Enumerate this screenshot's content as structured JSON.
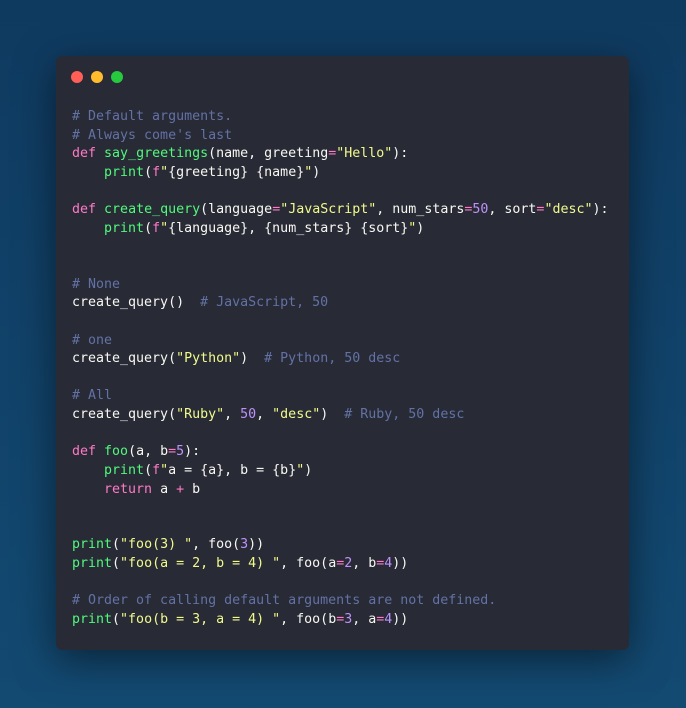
{
  "window": {
    "controls": [
      {
        "name": "close",
        "color": "#ff5f56"
      },
      {
        "name": "minimize",
        "color": "#ffbd2e"
      },
      {
        "name": "maximize",
        "color": "#27c93f"
      }
    ]
  },
  "theme": {
    "comment": "#6272a4",
    "keyword": "#ff79c6",
    "function": "#50fa7b",
    "string": "#f1fa8c",
    "number": "#bd93f9",
    "text": "#f8f8f2",
    "background": "#282a36"
  },
  "code": {
    "lines": [
      [
        [
          "c",
          "# Default arguments."
        ]
      ],
      [
        [
          "c",
          "# Always come's last"
        ]
      ],
      [
        [
          "k",
          "def"
        ],
        [
          "p",
          " "
        ],
        [
          "f",
          "say_greetings"
        ],
        [
          "p",
          "(name, greeting"
        ],
        [
          "o",
          "="
        ],
        [
          "s",
          "\"Hello\""
        ],
        [
          "p",
          "):"
        ]
      ],
      [
        [
          "p",
          "    "
        ],
        [
          "f",
          "print"
        ],
        [
          "p",
          "("
        ],
        [
          "k",
          "f"
        ],
        [
          "s",
          "\""
        ],
        [
          "p",
          "{greeting} {name}"
        ],
        [
          "s",
          "\""
        ],
        [
          "p",
          ")"
        ]
      ],
      [],
      [
        [
          "k",
          "def"
        ],
        [
          "p",
          " "
        ],
        [
          "f",
          "create_query"
        ],
        [
          "p",
          "(language"
        ],
        [
          "o",
          "="
        ],
        [
          "s",
          "\"JavaScript\""
        ],
        [
          "p",
          ", num_stars"
        ],
        [
          "o",
          "="
        ],
        [
          "n",
          "50"
        ],
        [
          "p",
          ", sort"
        ],
        [
          "o",
          "="
        ],
        [
          "s",
          "\"desc\""
        ],
        [
          "p",
          "):"
        ]
      ],
      [
        [
          "p",
          "    "
        ],
        [
          "f",
          "print"
        ],
        [
          "p",
          "("
        ],
        [
          "k",
          "f"
        ],
        [
          "s",
          "\""
        ],
        [
          "p",
          "{language}, {num_stars} {sort}"
        ],
        [
          "s",
          "\""
        ],
        [
          "p",
          ")"
        ]
      ],
      [],
      [],
      [
        [
          "c",
          "# None"
        ]
      ],
      [
        [
          "p",
          "create_query()  "
        ],
        [
          "c",
          "# JavaScript, 50"
        ]
      ],
      [],
      [
        [
          "c",
          "# one"
        ]
      ],
      [
        [
          "p",
          "create_query("
        ],
        [
          "s",
          "\"Python\""
        ],
        [
          "p",
          ")  "
        ],
        [
          "c",
          "# Python, 50 desc"
        ]
      ],
      [],
      [
        [
          "c",
          "# All"
        ]
      ],
      [
        [
          "p",
          "create_query("
        ],
        [
          "s",
          "\"Ruby\""
        ],
        [
          "p",
          ", "
        ],
        [
          "n",
          "50"
        ],
        [
          "p",
          ", "
        ],
        [
          "s",
          "\"desc\""
        ],
        [
          "p",
          ")  "
        ],
        [
          "c",
          "# Ruby, 50 desc"
        ]
      ],
      [],
      [
        [
          "k",
          "def"
        ],
        [
          "p",
          " "
        ],
        [
          "f",
          "foo"
        ],
        [
          "p",
          "(a, b"
        ],
        [
          "o",
          "="
        ],
        [
          "n",
          "5"
        ],
        [
          "p",
          "):"
        ]
      ],
      [
        [
          "p",
          "    "
        ],
        [
          "f",
          "print"
        ],
        [
          "p",
          "("
        ],
        [
          "k",
          "f"
        ],
        [
          "s",
          "\""
        ],
        [
          "p",
          "a = {a}, b = {b}"
        ],
        [
          "s",
          "\""
        ],
        [
          "p",
          ")"
        ]
      ],
      [
        [
          "p",
          "    "
        ],
        [
          "k",
          "return"
        ],
        [
          "p",
          " a "
        ],
        [
          "o",
          "+"
        ],
        [
          "p",
          " b"
        ]
      ],
      [],
      [],
      [
        [
          "f",
          "print"
        ],
        [
          "p",
          "("
        ],
        [
          "s",
          "\"foo(3) \""
        ],
        [
          "p",
          ", foo("
        ],
        [
          "n",
          "3"
        ],
        [
          "p",
          "))"
        ]
      ],
      [
        [
          "f",
          "print"
        ],
        [
          "p",
          "("
        ],
        [
          "s",
          "\"foo(a = 2, b = 4) \""
        ],
        [
          "p",
          ", foo(a"
        ],
        [
          "o",
          "="
        ],
        [
          "n",
          "2"
        ],
        [
          "p",
          ", b"
        ],
        [
          "o",
          "="
        ],
        [
          "n",
          "4"
        ],
        [
          "p",
          "))"
        ]
      ],
      [],
      [
        [
          "c",
          "# Order of calling default arguments are not defined."
        ]
      ],
      [
        [
          "f",
          "print"
        ],
        [
          "p",
          "("
        ],
        [
          "s",
          "\"foo(b = 3, a = 4) \""
        ],
        [
          "p",
          ", foo(b"
        ],
        [
          "o",
          "="
        ],
        [
          "n",
          "3"
        ],
        [
          "p",
          ", a"
        ],
        [
          "o",
          "="
        ],
        [
          "n",
          "4"
        ],
        [
          "p",
          "))"
        ]
      ]
    ]
  }
}
